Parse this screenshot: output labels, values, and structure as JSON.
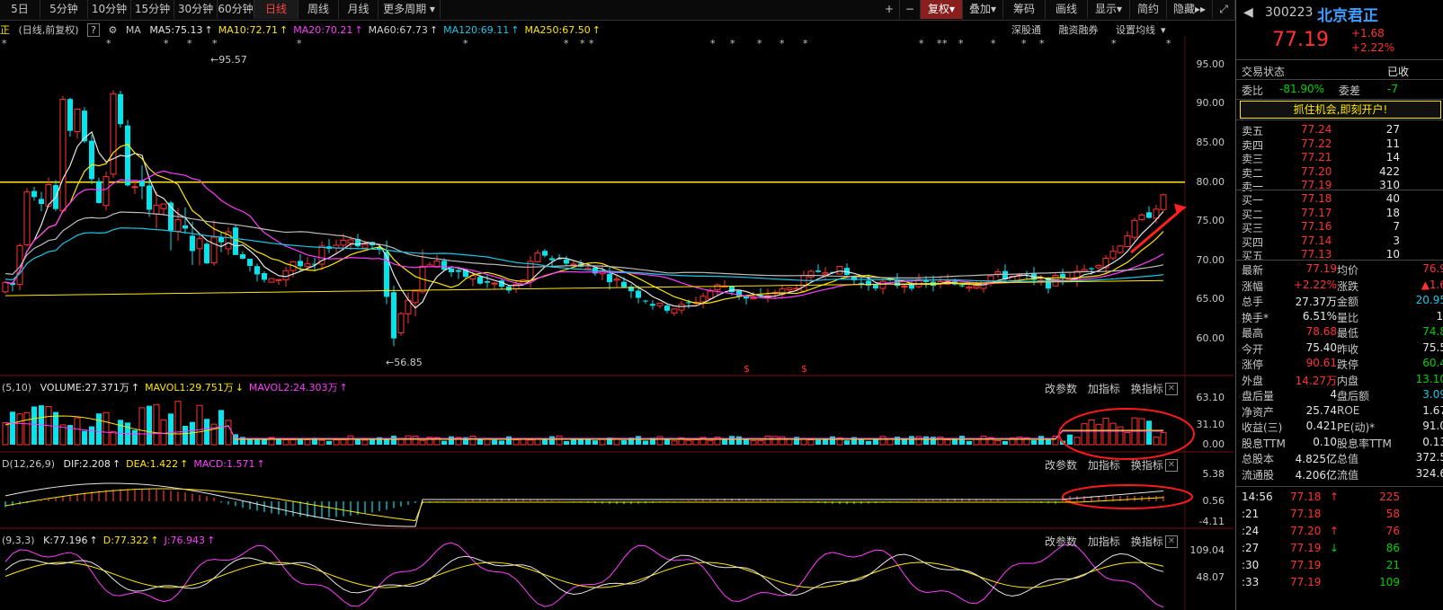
{
  "toolbar": {
    "periods": [
      "5日",
      "5分钟",
      "10分钟",
      "15分钟",
      "30分钟",
      "60分钟",
      "日线",
      "周线",
      "月线",
      "更多周期"
    ],
    "active_period": "日线",
    "tools": [
      "+",
      "−",
      "复权",
      "叠加",
      "筹码",
      "画线",
      "显示",
      "简约",
      "隐藏"
    ],
    "more_periods_arrow": "▾"
  },
  "stock": {
    "code": "300223",
    "name": "北京君正",
    "name_short": "正",
    "price": "77.19",
    "change": "+1.68",
    "change_pct": "+2.22%"
  },
  "kline": {
    "header_label": "(日线,前复权)",
    "help": "?",
    "ma_label": "MA",
    "ma": [
      {
        "label": "MA5:75.13",
        "color": "#e6e6e6"
      },
      {
        "label": "MA10:72.71",
        "color": "#ffe600"
      },
      {
        "label": "MA20:70.21",
        "color": "#ff3cff"
      },
      {
        "label": "MA60:67.73",
        "color": "#d0d0d0"
      },
      {
        "label": "MA120:69.11",
        "color": "#19c8e6"
      },
      {
        "label": "MA250:67.50",
        "color": "#ffe600"
      }
    ],
    "links": [
      "深股通",
      "融资融券",
      "设置均线"
    ],
    "price_axis": [
      "95.00",
      "90.00",
      "85.00",
      "80.00",
      "75.00",
      "70.00",
      "65.00",
      "60.00"
    ],
    "high_marker": "95.57",
    "low_marker": "56.85",
    "dollar_marks": [
      "$",
      "$"
    ],
    "horizontal_line": 80.0
  },
  "volume": {
    "label": "(5,10)",
    "items": [
      {
        "label": "VOLUME:27.371万",
        "color": "#e6e6e6"
      },
      {
        "label": "MAVOL1:29.751万",
        "color": "#ffe600"
      },
      {
        "label": "MAVOL2:24.303万",
        "color": "#ff3cff"
      }
    ],
    "axis": [
      "63.10",
      "31.10",
      "0.00"
    ]
  },
  "macd": {
    "label": "D(12,26,9)",
    "items": [
      {
        "label": "DIF:2.208",
        "color": "#e6e6e6"
      },
      {
        "label": "DEA:1.422",
        "color": "#ffe600"
      },
      {
        "label": "MACD:1.571",
        "color": "#ff3cff"
      }
    ],
    "axis": [
      "5.38",
      "0.56",
      "-4.11"
    ]
  },
  "kdj": {
    "label": "(9,3,3)",
    "items": [
      {
        "label": "K:77.196",
        "color": "#e6e6e6"
      },
      {
        "label": "D:77.322",
        "color": "#ffe600"
      },
      {
        "label": "J:76.943",
        "color": "#ff3cff"
      }
    ],
    "axis": [
      "109.04",
      "48.07"
    ]
  },
  "panel_controls": [
    "改参数",
    "加指标",
    "换指标"
  ],
  "right_panel": {
    "trade_status_label": "交易状态",
    "trade_status_value": "已收",
    "weibi_label": "委比",
    "weibi_value": "-81.90%",
    "weicha_label": "委差",
    "weicha_value": "-7",
    "promo": "抓住机会,即刻开户!",
    "sells": [
      {
        "label": "卖五",
        "price": "77.24",
        "vol": "27"
      },
      {
        "label": "卖四",
        "price": "77.22",
        "vol": "11"
      },
      {
        "label": "卖三",
        "price": "77.21",
        "vol": "14"
      },
      {
        "label": "卖二",
        "price": "77.20",
        "vol": "422"
      },
      {
        "label": "卖一",
        "price": "77.19",
        "vol": "310"
      }
    ],
    "buys": [
      {
        "label": "买一",
        "price": "77.18",
        "vol": "40"
      },
      {
        "label": "买二",
        "price": "77.17",
        "vol": "18"
      },
      {
        "label": "买三",
        "price": "77.16",
        "vol": "7"
      },
      {
        "label": "买四",
        "price": "77.14",
        "vol": "3"
      },
      {
        "label": "买五",
        "price": "77.13",
        "vol": "10"
      }
    ],
    "stats": [
      {
        "l1": "最新",
        "v1": "77.19",
        "c1": "red",
        "l2": "均价",
        "v2": "76.9",
        "c2": "red"
      },
      {
        "l1": "涨幅",
        "v1": "+2.22%",
        "c1": "red",
        "l2": "涨跌",
        "v2": "▲1.6",
        "c2": "red"
      },
      {
        "l1": "总手",
        "v1": "27.37万",
        "c1": "white",
        "l2": "金额",
        "v2": "20.95",
        "c2": "cyan"
      },
      {
        "l1": "换手*",
        "v1": "6.51%",
        "c1": "white",
        "l2": "量比",
        "v2": "1.",
        "c2": "white"
      },
      {
        "l1": "最高",
        "v1": "78.68",
        "c1": "red",
        "l2": "最低",
        "v2": "74.8",
        "c2": "green"
      },
      {
        "l1": "今开",
        "v1": "75.40",
        "c1": "white",
        "l2": "昨收",
        "v2": "75.5",
        "c2": "white"
      },
      {
        "l1": "涨停",
        "v1": "90.61",
        "c1": "red",
        "l2": "跌停",
        "v2": "60.4",
        "c2": "green"
      },
      {
        "l1": "外盘",
        "v1": "14.27万",
        "c1": "red",
        "l2": "内盘",
        "v2": "13.10",
        "c2": "green"
      },
      {
        "l1": "盘后量",
        "v1": "4",
        "c1": "white",
        "l2": "盘后额",
        "v2": "3.09",
        "c2": "cyan"
      },
      {
        "l1": "净资产",
        "v1": "25.74",
        "c1": "white",
        "l2": "ROE",
        "v2": "1.67",
        "c2": "white"
      },
      {
        "l1": "收益(三)",
        "v1": "0.421",
        "c1": "white",
        "l2": "PE(动)*",
        "v2": "91.0",
        "c2": "white"
      },
      {
        "l1": "股息TTM",
        "v1": "0.10",
        "c1": "white",
        "l2": "股息率TTM",
        "v2": "0.13",
        "c2": "white"
      },
      {
        "l1": "总股本",
        "v1": "4.825亿",
        "c1": "white",
        "l2": "总值",
        "v2": "372.5",
        "c2": "white"
      },
      {
        "l1": "流通股",
        "v1": "4.206亿",
        "c1": "white",
        "l2": "流值",
        "v2": "324.6",
        "c2": "white"
      }
    ],
    "ticks": [
      {
        "time": "14:56",
        "price": "77.18",
        "arrow": "↑",
        "vol": "225",
        "c": "red"
      },
      {
        "time": ":21",
        "price": "77.18",
        "arrow": "",
        "vol": "58",
        "c": "red"
      },
      {
        "time": ":24",
        "price": "77.20",
        "arrow": "↑",
        "vol": "76",
        "c": "red"
      },
      {
        "time": ":27",
        "price": "77.19",
        "arrow": "↓",
        "vol": "86",
        "c": "green"
      },
      {
        "time": ":30",
        "price": "77.19",
        "arrow": "",
        "vol": "21",
        "c": "green"
      },
      {
        "time": ":33",
        "price": "77.19",
        "arrow": "",
        "vol": "109",
        "c": "green"
      }
    ]
  }
}
